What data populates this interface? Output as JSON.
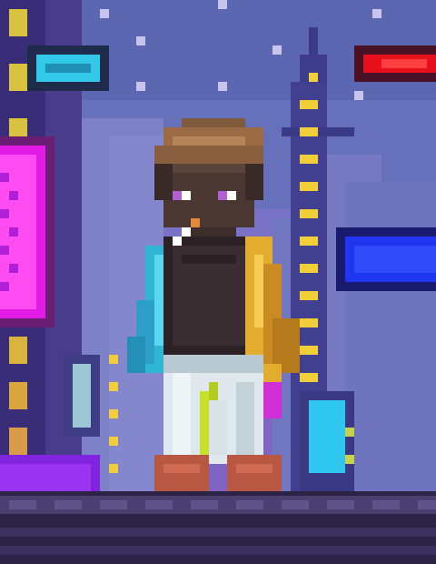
{
  "scene": {
    "setting": "neon-city-night",
    "palette": {
      "sky_top": "#5d6ab4",
      "sky_bottom": "#8b61bf",
      "neon_cyan": "#32c9e8",
      "neon_red": "#e8101b",
      "neon_magenta": "#e21be6",
      "neon_blue": "#1f35f0",
      "window_yellow": "#f0cf3a",
      "sidewalk": "#2d2347"
    },
    "character": {
      "skin": "#4b3732",
      "hair": "#9a6b45",
      "shirt": "#2c2226",
      "sleeve_left": "#2fb6d5",
      "sleeve_right": "#e2ac2f",
      "pants": "#dfe8ec",
      "shoes": "#b85742"
    }
  }
}
